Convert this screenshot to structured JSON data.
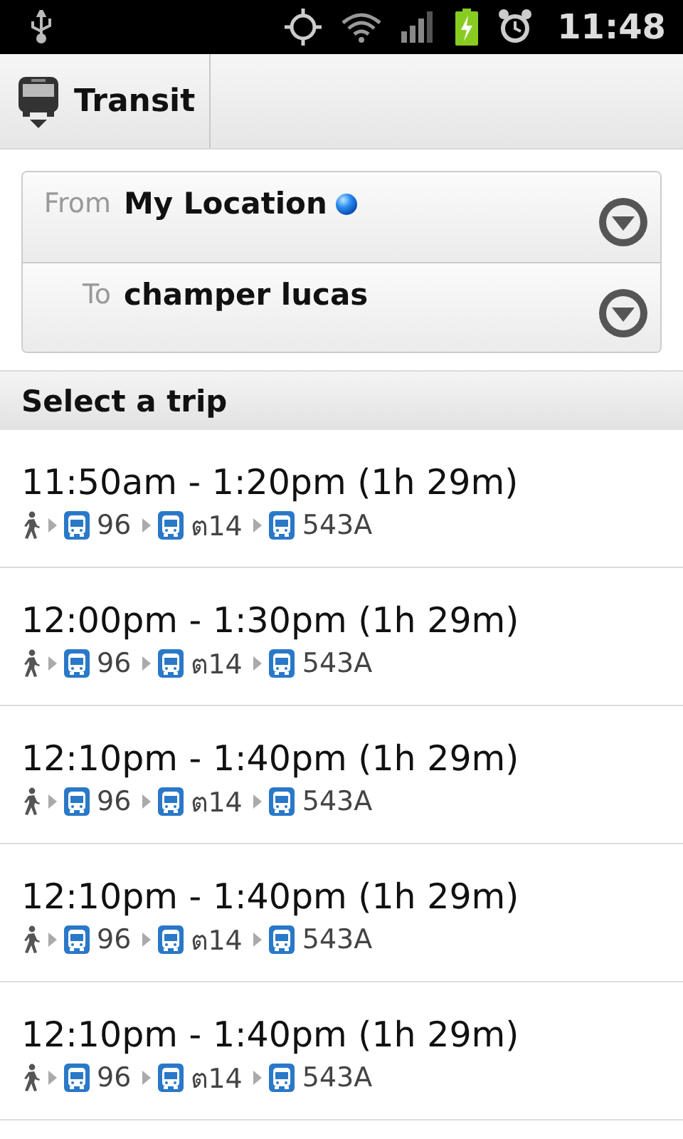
{
  "status_bar": {
    "time": "11:48"
  },
  "app_bar": {
    "title": "Transit"
  },
  "route_form": {
    "fields": [
      {
        "label": "From",
        "value": "My Location",
        "kind": "location"
      },
      {
        "label": "To",
        "value": "champer lucas",
        "kind": "place"
      }
    ]
  },
  "section": {
    "title": "Select a trip"
  },
  "trips": [
    {
      "time": "11:50am - 1:20pm (1h 29m)",
      "steps": [
        {
          "kind": "walk"
        },
        {
          "kind": "bus",
          "route": "96"
        },
        {
          "kind": "bus",
          "route": "ต14"
        },
        {
          "kind": "bus",
          "route": "543A"
        }
      ]
    },
    {
      "time": "12:00pm - 1:30pm (1h 29m)",
      "steps": [
        {
          "kind": "walk"
        },
        {
          "kind": "bus",
          "route": "96"
        },
        {
          "kind": "bus",
          "route": "ต14"
        },
        {
          "kind": "bus",
          "route": "543A"
        }
      ]
    },
    {
      "time": "12:10pm - 1:40pm (1h 29m)",
      "steps": [
        {
          "kind": "walk"
        },
        {
          "kind": "bus",
          "route": "96"
        },
        {
          "kind": "bus",
          "route": "ต14"
        },
        {
          "kind": "bus",
          "route": "543A"
        }
      ]
    },
    {
      "time": "12:10pm - 1:40pm (1h 29m)",
      "steps": [
        {
          "kind": "walk"
        },
        {
          "kind": "bus",
          "route": "96"
        },
        {
          "kind": "bus",
          "route": "ต14"
        },
        {
          "kind": "bus",
          "route": "543A"
        }
      ]
    },
    {
      "time": "12:10pm - 1:40pm (1h 29m)",
      "steps": [
        {
          "kind": "walk"
        },
        {
          "kind": "bus",
          "route": "96"
        },
        {
          "kind": "bus",
          "route": "ต14"
        },
        {
          "kind": "bus",
          "route": "543A"
        }
      ]
    }
  ]
}
